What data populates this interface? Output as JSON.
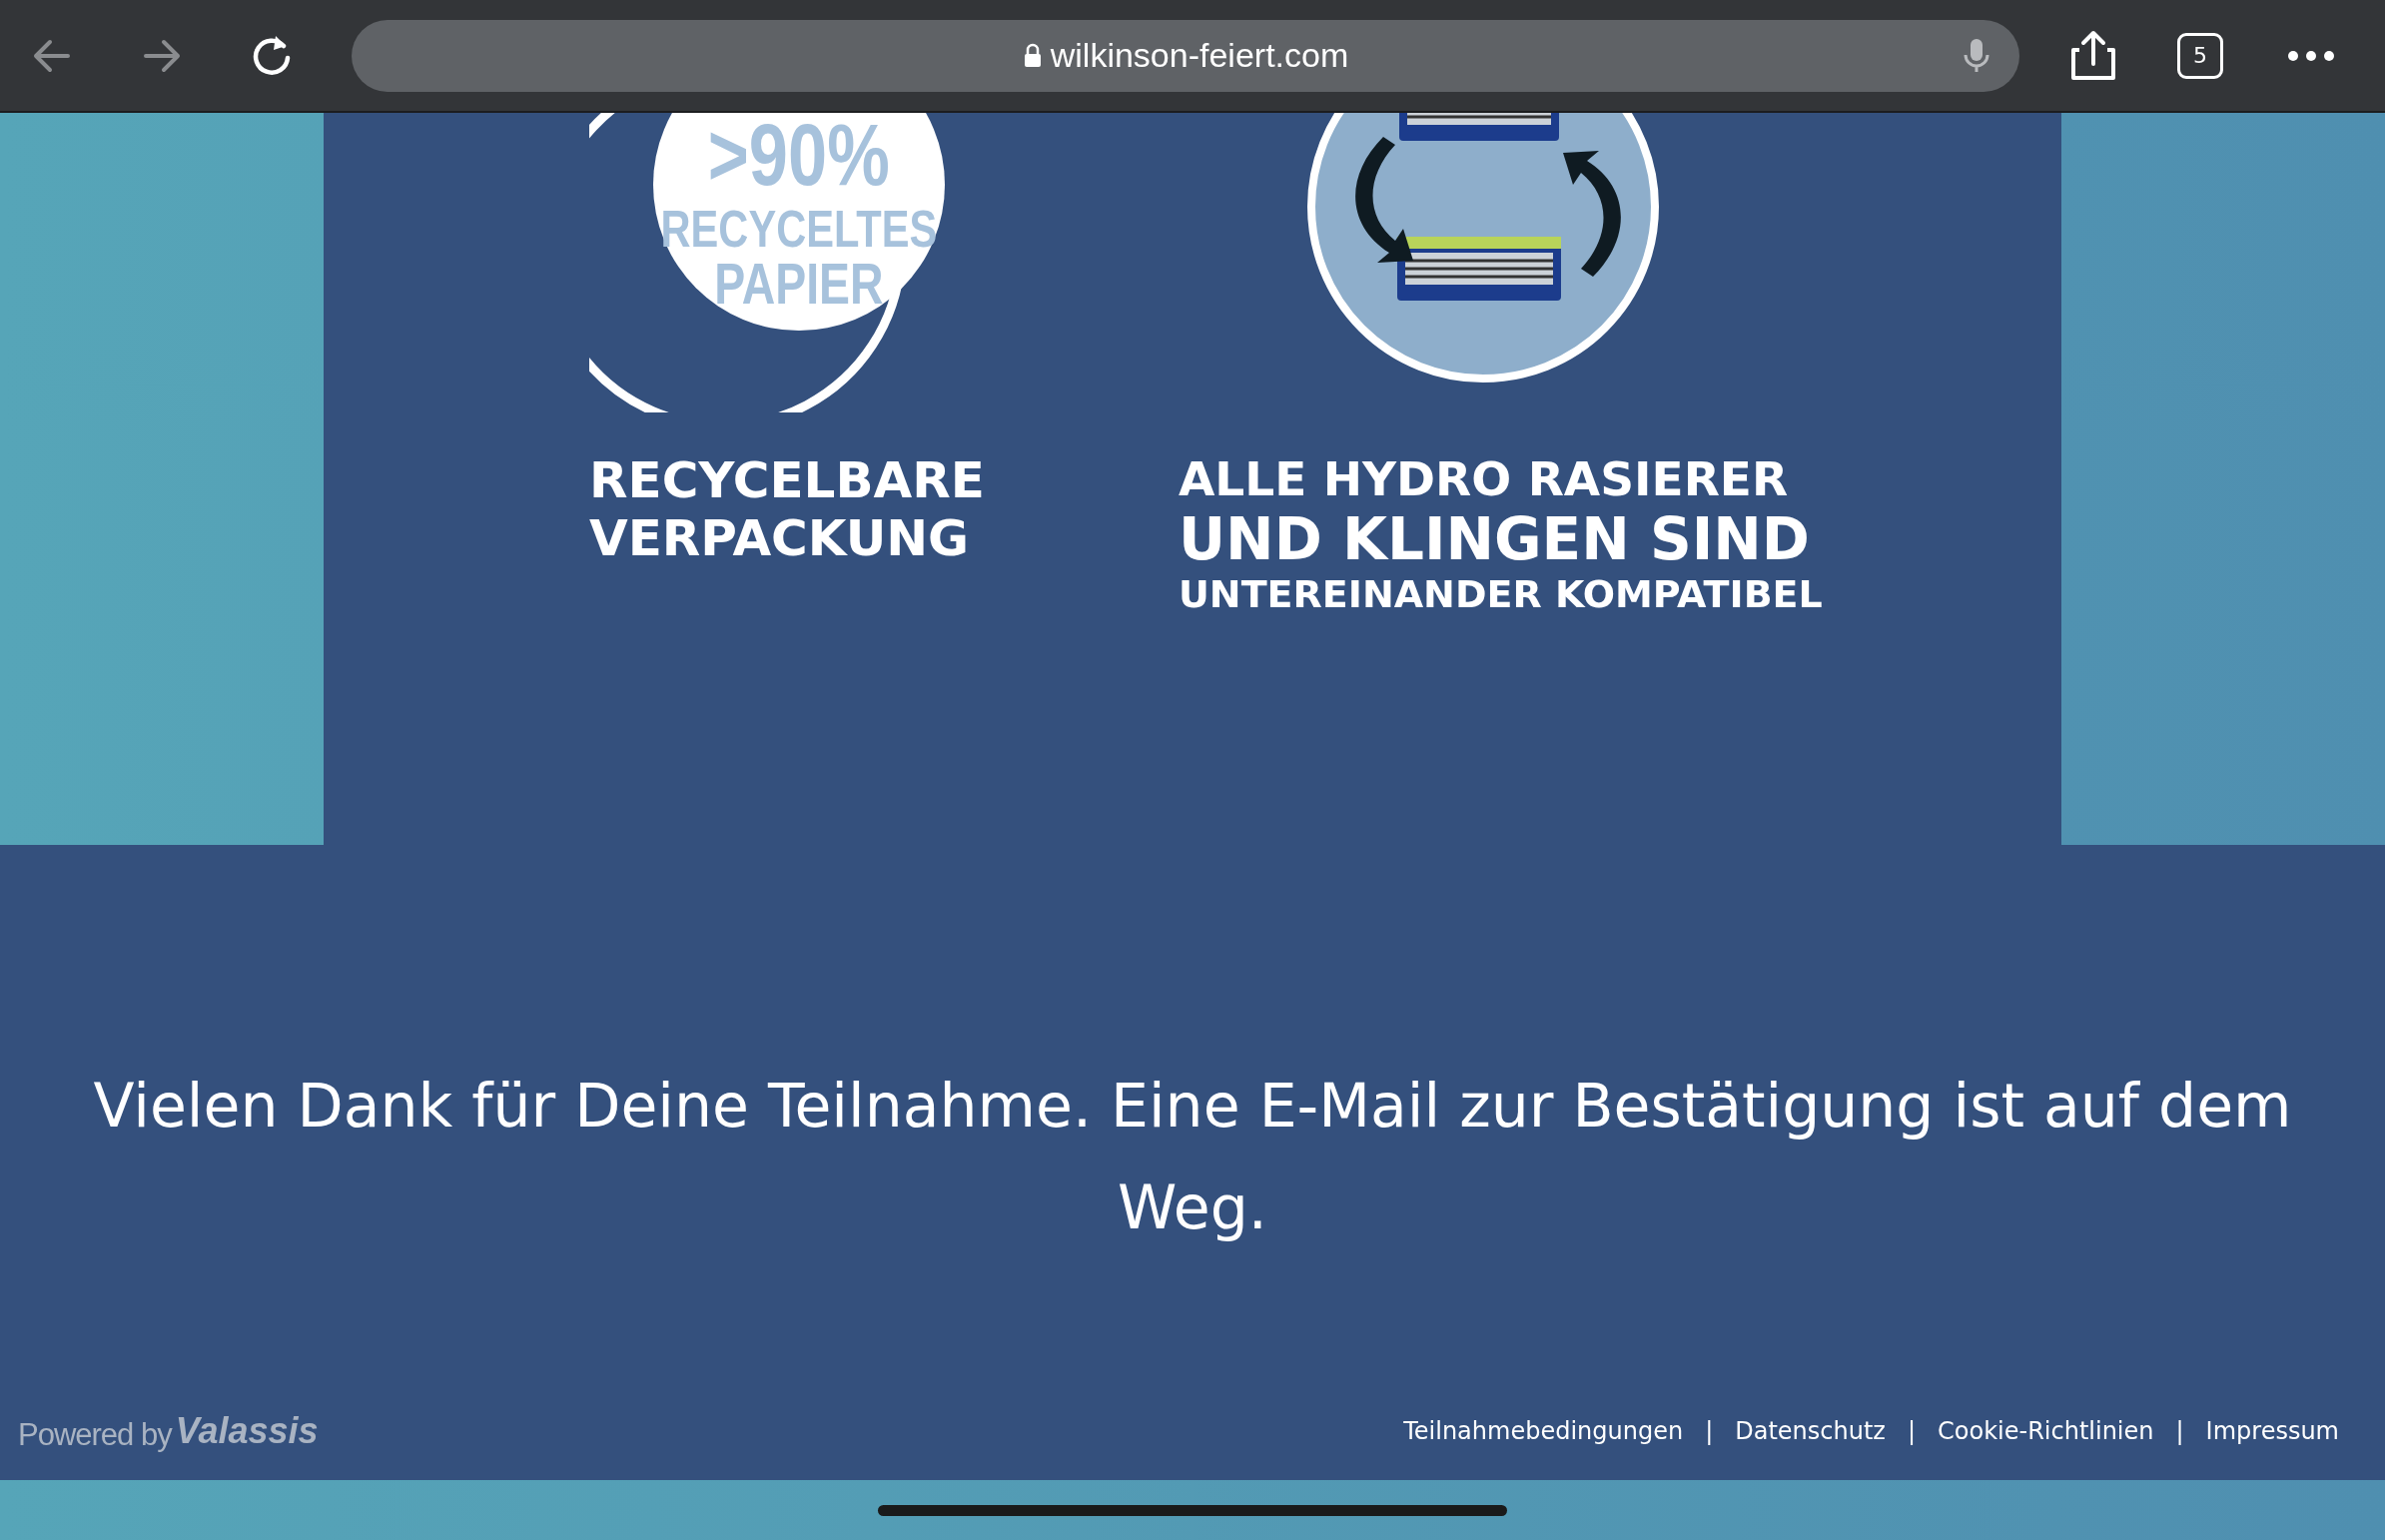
{
  "browser": {
    "url": "wilkinson-feiert.com",
    "tab_count": "5"
  },
  "features": [
    {
      "kind": "recycle",
      "badge": [
        ">90%",
        "RECYCELTES",
        "PAPIER"
      ],
      "caption": [
        "RECYCELBARE",
        "VERPACKUNG"
      ]
    },
    {
      "kind": "razor",
      "caption": [
        "ALLE HYDRO RASIERER",
        "UND KLINGEN SIND",
        "UNTEREINANDER KOMPATIBEL"
      ]
    }
  ],
  "message": "Vielen Dank für Deine Teilnahme. Eine E-Mail zur Bestätigung ist auf dem Weg.",
  "footer": {
    "powered_by": "Powered by",
    "brand": "Valassis",
    "links": [
      "Teilnahmebedingungen",
      "Datenschutz",
      "Cookie-Richtlinien",
      "Impressum"
    ],
    "separators": [
      "|",
      "|",
      "|"
    ]
  }
}
